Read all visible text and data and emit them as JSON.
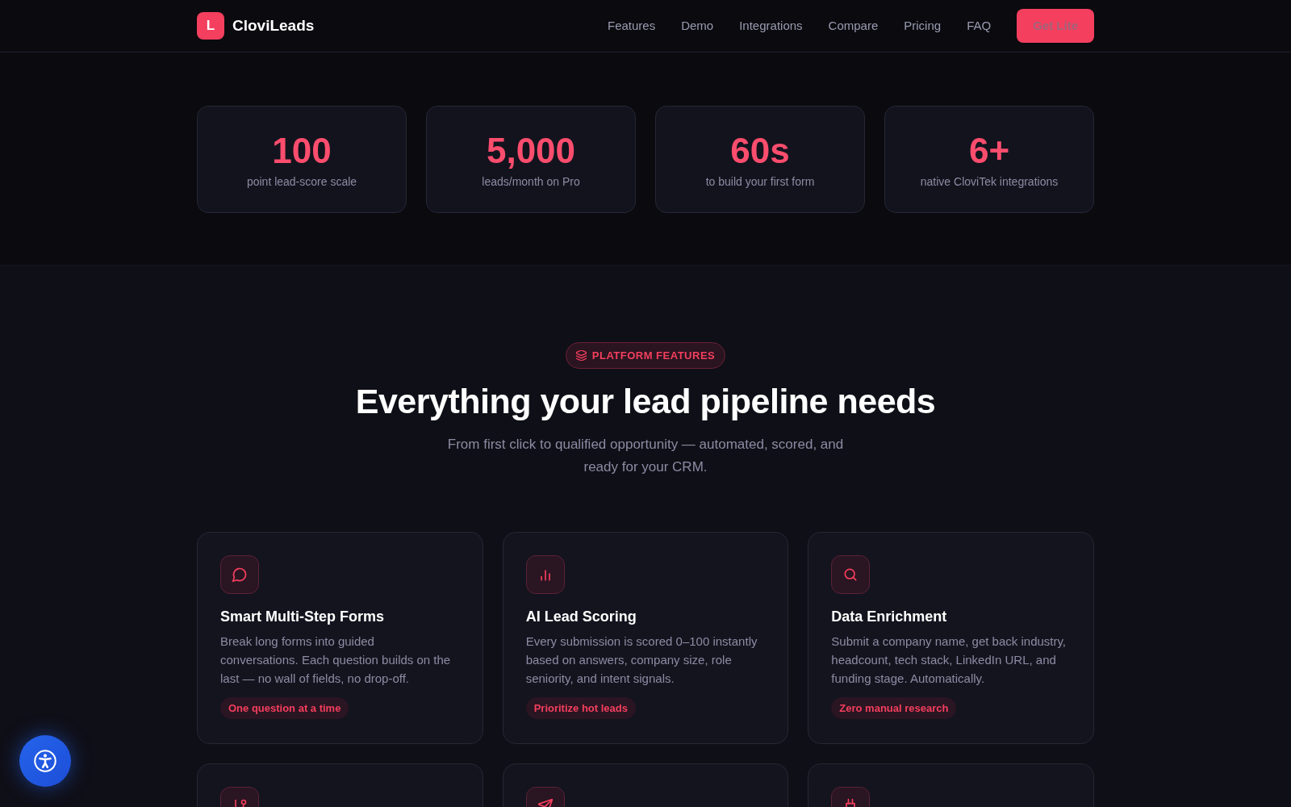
{
  "header": {
    "logo_letter": "L",
    "brand": "CloviLeads",
    "nav_links": [
      "Features",
      "Demo",
      "Integrations",
      "Compare",
      "Pricing",
      "FAQ"
    ],
    "cta": "Get Lite"
  },
  "stats": [
    {
      "value": "100",
      "label": "point lead-score scale"
    },
    {
      "value": "5,000",
      "label": "leads/month on Pro"
    },
    {
      "value": "60s",
      "label": "to build your first form"
    },
    {
      "value": "6+",
      "label": "native CloviTek integrations"
    }
  ],
  "features_section": {
    "badge": "PLATFORM FEATURES",
    "heading": "Everything your lead pipeline needs",
    "subtitle": "From first click to qualified opportunity — automated, scored, and ready for your CRM.",
    "cards": [
      {
        "kind": "full",
        "title": "Smart Multi-Step Forms",
        "description": "Break long forms into guided conversations. Each question builds on the last — no wall of fields, no drop-off.",
        "tag": "One question at a time"
      },
      {
        "kind": "full",
        "title": "AI Lead Scoring",
        "description": "Every submission is scored 0–100 instantly based on answers, company size, role seniority, and intent signals.",
        "tag": "Prioritize hot leads"
      },
      {
        "kind": "full",
        "title": "Data Enrichment",
        "description": "Submit a company name, get back industry, headcount, tech stack, LinkedIn URL, and funding stage. Automatically.",
        "tag": "Zero manual research"
      },
      {
        "kind": "clipped"
      },
      {
        "kind": "clipped"
      },
      {
        "kind": "clipped"
      }
    ]
  }
}
